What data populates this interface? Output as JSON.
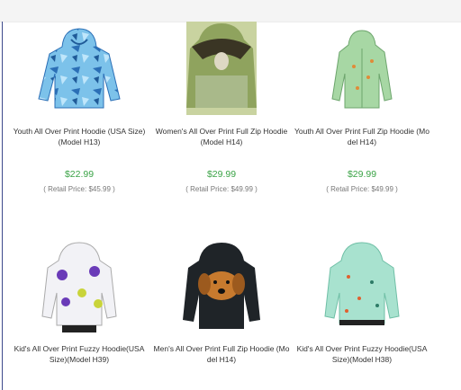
{
  "products": [
    {
      "title": "Youth All Over Print Hoodie (USA Size) (Model H13)",
      "price": "$22.99",
      "retail": "( Retail Price: $45.99 )",
      "image_icon": "blue-camo-hoodie-icon"
    },
    {
      "title": "Women's All Over Print Full Zip Hoodie (Model H14)",
      "price": "$29.99",
      "retail": "( Retail Price: $49.99 )",
      "image_icon": "eagle-print-hoodie-icon"
    },
    {
      "title": "Youth All Over Print Full Zip Hoodie (Model H14)",
      "price": "$29.99",
      "retail": "( Retail Price: $49.99 )",
      "image_icon": "green-leaf-hoodie-icon"
    },
    {
      "title": "Kid's All Over Print Fuzzy Hoodie(USA Size)(Model H39)",
      "image_icon": "purple-flower-hoodie-icon"
    },
    {
      "title": "Men's All Over Print Full Zip Hoodie (Model H14)",
      "image_icon": "dog-print-hoodie-icon"
    },
    {
      "title": "Kid's All Over Print Fuzzy Hoodie(USA Size)(Model H38)",
      "image_icon": "mint-pattern-hoodie-icon"
    }
  ],
  "colors": {
    "price": "#3aa346",
    "accent_line": "#3e4a8c"
  }
}
